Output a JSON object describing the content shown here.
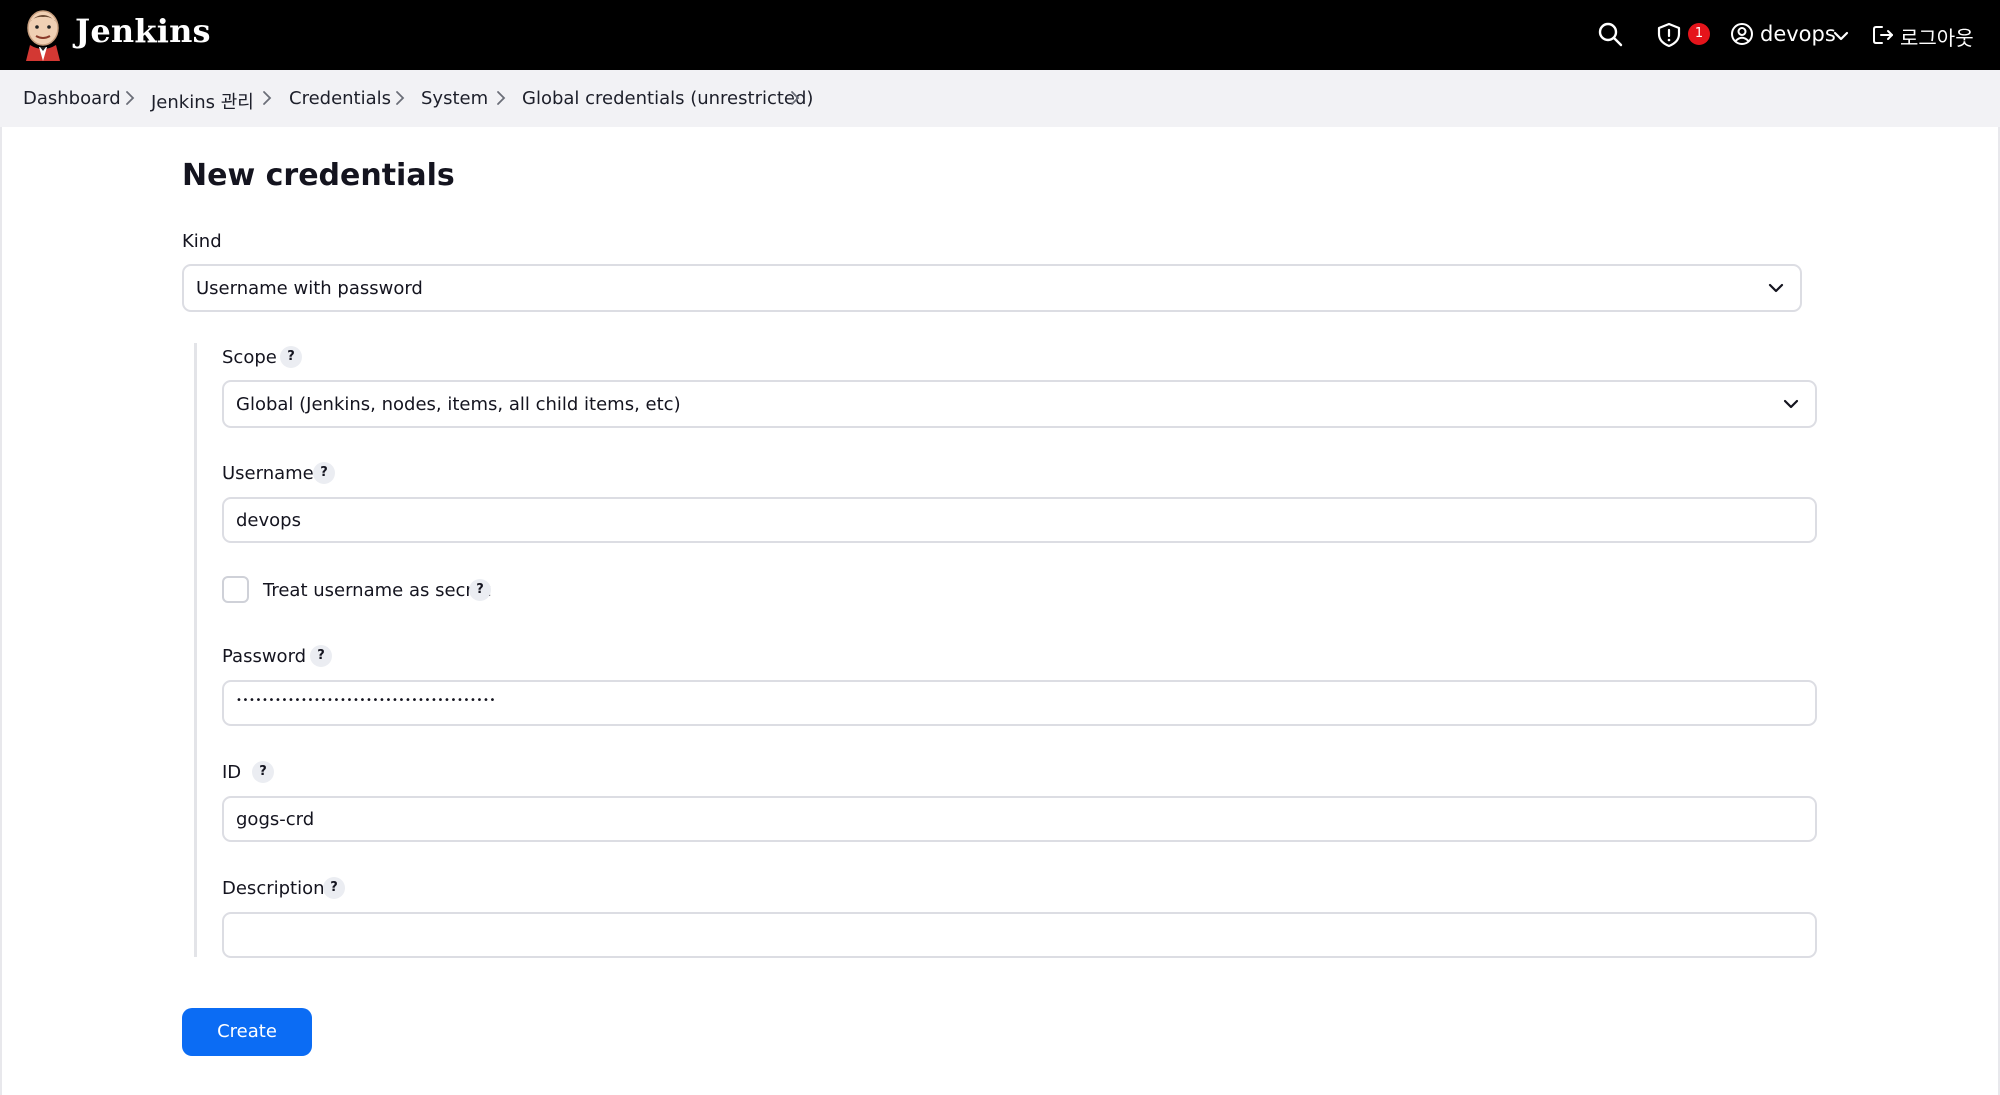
{
  "app": {
    "brand": "Jenkins"
  },
  "header": {
    "security_badge_count": "1",
    "user_name": "devops",
    "logout_label": "로그아웃"
  },
  "breadcrumb": [
    {
      "label": "Dashboard"
    },
    {
      "label": "Jenkins 관리"
    },
    {
      "label": "Credentials"
    },
    {
      "label": "System"
    },
    {
      "label": "Global credentials (unrestricted)"
    }
  ],
  "form": {
    "title": "New credentials",
    "kind": {
      "label": "Kind",
      "value": "Username with password"
    },
    "scope": {
      "label": "Scope",
      "help": "?",
      "value": "Global (Jenkins, nodes, items, all child items, etc)"
    },
    "username": {
      "label": "Username",
      "help": "?",
      "value": "devops"
    },
    "treat_secret": {
      "label": "Treat username as secret",
      "help": "?",
      "checked": false
    },
    "password": {
      "label": "Password",
      "help": "?",
      "value": "••••••••••••••••••••••••••••••••••••••••"
    },
    "id": {
      "label": "ID",
      "help": "?",
      "value": "gogs-crd"
    },
    "description": {
      "label": "Description",
      "help": "?",
      "value": ""
    },
    "create_label": "Create"
  },
  "icons": {
    "logo": "jenkins-butler-logo",
    "search": "search-icon",
    "security": "shield-icon",
    "user": "user-circle-icon",
    "user_menu": "chevron-down-icon",
    "logout": "logout-icon",
    "breadcrumb_separator": "chevron-right-icon"
  },
  "colors": {
    "header_bg": "#000000",
    "breadcrumb_bg": "#f2f2f5",
    "primary_button": "#0b6cf4",
    "badge": "#e5141b"
  }
}
